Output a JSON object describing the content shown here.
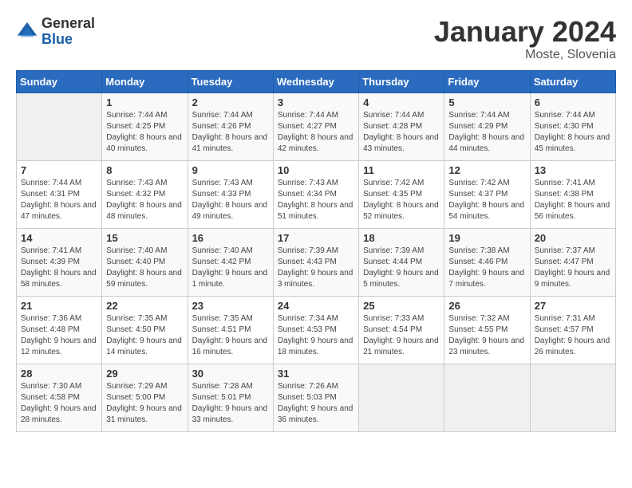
{
  "header": {
    "logo_general": "General",
    "logo_blue": "Blue",
    "title": "January 2024",
    "subtitle": "Moste, Slovenia"
  },
  "weekdays": [
    "Sunday",
    "Monday",
    "Tuesday",
    "Wednesday",
    "Thursday",
    "Friday",
    "Saturday"
  ],
  "weeks": [
    [
      {
        "day": "",
        "sunrise": "",
        "sunset": "",
        "daylight": "",
        "empty": true
      },
      {
        "day": "1",
        "sunrise": "Sunrise: 7:44 AM",
        "sunset": "Sunset: 4:25 PM",
        "daylight": "Daylight: 8 hours and 40 minutes."
      },
      {
        "day": "2",
        "sunrise": "Sunrise: 7:44 AM",
        "sunset": "Sunset: 4:26 PM",
        "daylight": "Daylight: 8 hours and 41 minutes."
      },
      {
        "day": "3",
        "sunrise": "Sunrise: 7:44 AM",
        "sunset": "Sunset: 4:27 PM",
        "daylight": "Daylight: 8 hours and 42 minutes."
      },
      {
        "day": "4",
        "sunrise": "Sunrise: 7:44 AM",
        "sunset": "Sunset: 4:28 PM",
        "daylight": "Daylight: 8 hours and 43 minutes."
      },
      {
        "day": "5",
        "sunrise": "Sunrise: 7:44 AM",
        "sunset": "Sunset: 4:29 PM",
        "daylight": "Daylight: 8 hours and 44 minutes."
      },
      {
        "day": "6",
        "sunrise": "Sunrise: 7:44 AM",
        "sunset": "Sunset: 4:30 PM",
        "daylight": "Daylight: 8 hours and 45 minutes."
      }
    ],
    [
      {
        "day": "7",
        "sunrise": "Sunrise: 7:44 AM",
        "sunset": "Sunset: 4:31 PM",
        "daylight": "Daylight: 8 hours and 47 minutes."
      },
      {
        "day": "8",
        "sunrise": "Sunrise: 7:43 AM",
        "sunset": "Sunset: 4:32 PM",
        "daylight": "Daylight: 8 hours and 48 minutes."
      },
      {
        "day": "9",
        "sunrise": "Sunrise: 7:43 AM",
        "sunset": "Sunset: 4:33 PM",
        "daylight": "Daylight: 8 hours and 49 minutes."
      },
      {
        "day": "10",
        "sunrise": "Sunrise: 7:43 AM",
        "sunset": "Sunset: 4:34 PM",
        "daylight": "Daylight: 8 hours and 51 minutes."
      },
      {
        "day": "11",
        "sunrise": "Sunrise: 7:42 AM",
        "sunset": "Sunset: 4:35 PM",
        "daylight": "Daylight: 8 hours and 52 minutes."
      },
      {
        "day": "12",
        "sunrise": "Sunrise: 7:42 AM",
        "sunset": "Sunset: 4:37 PM",
        "daylight": "Daylight: 8 hours and 54 minutes."
      },
      {
        "day": "13",
        "sunrise": "Sunrise: 7:41 AM",
        "sunset": "Sunset: 4:38 PM",
        "daylight": "Daylight: 8 hours and 56 minutes."
      }
    ],
    [
      {
        "day": "14",
        "sunrise": "Sunrise: 7:41 AM",
        "sunset": "Sunset: 4:39 PM",
        "daylight": "Daylight: 8 hours and 58 minutes."
      },
      {
        "day": "15",
        "sunrise": "Sunrise: 7:40 AM",
        "sunset": "Sunset: 4:40 PM",
        "daylight": "Daylight: 8 hours and 59 minutes."
      },
      {
        "day": "16",
        "sunrise": "Sunrise: 7:40 AM",
        "sunset": "Sunset: 4:42 PM",
        "daylight": "Daylight: 9 hours and 1 minute."
      },
      {
        "day": "17",
        "sunrise": "Sunrise: 7:39 AM",
        "sunset": "Sunset: 4:43 PM",
        "daylight": "Daylight: 9 hours and 3 minutes."
      },
      {
        "day": "18",
        "sunrise": "Sunrise: 7:39 AM",
        "sunset": "Sunset: 4:44 PM",
        "daylight": "Daylight: 9 hours and 5 minutes."
      },
      {
        "day": "19",
        "sunrise": "Sunrise: 7:38 AM",
        "sunset": "Sunset: 4:46 PM",
        "daylight": "Daylight: 9 hours and 7 minutes."
      },
      {
        "day": "20",
        "sunrise": "Sunrise: 7:37 AM",
        "sunset": "Sunset: 4:47 PM",
        "daylight": "Daylight: 9 hours and 9 minutes."
      }
    ],
    [
      {
        "day": "21",
        "sunrise": "Sunrise: 7:36 AM",
        "sunset": "Sunset: 4:48 PM",
        "daylight": "Daylight: 9 hours and 12 minutes."
      },
      {
        "day": "22",
        "sunrise": "Sunrise: 7:35 AM",
        "sunset": "Sunset: 4:50 PM",
        "daylight": "Daylight: 9 hours and 14 minutes."
      },
      {
        "day": "23",
        "sunrise": "Sunrise: 7:35 AM",
        "sunset": "Sunset: 4:51 PM",
        "daylight": "Daylight: 9 hours and 16 minutes."
      },
      {
        "day": "24",
        "sunrise": "Sunrise: 7:34 AM",
        "sunset": "Sunset: 4:53 PM",
        "daylight": "Daylight: 9 hours and 18 minutes."
      },
      {
        "day": "25",
        "sunrise": "Sunrise: 7:33 AM",
        "sunset": "Sunset: 4:54 PM",
        "daylight": "Daylight: 9 hours and 21 minutes."
      },
      {
        "day": "26",
        "sunrise": "Sunrise: 7:32 AM",
        "sunset": "Sunset: 4:55 PM",
        "daylight": "Daylight: 9 hours and 23 minutes."
      },
      {
        "day": "27",
        "sunrise": "Sunrise: 7:31 AM",
        "sunset": "Sunset: 4:57 PM",
        "daylight": "Daylight: 9 hours and 26 minutes."
      }
    ],
    [
      {
        "day": "28",
        "sunrise": "Sunrise: 7:30 AM",
        "sunset": "Sunset: 4:58 PM",
        "daylight": "Daylight: 9 hours and 28 minutes."
      },
      {
        "day": "29",
        "sunrise": "Sunrise: 7:29 AM",
        "sunset": "Sunset: 5:00 PM",
        "daylight": "Daylight: 9 hours and 31 minutes."
      },
      {
        "day": "30",
        "sunrise": "Sunrise: 7:28 AM",
        "sunset": "Sunset: 5:01 PM",
        "daylight": "Daylight: 9 hours and 33 minutes."
      },
      {
        "day": "31",
        "sunrise": "Sunrise: 7:26 AM",
        "sunset": "Sunset: 5:03 PM",
        "daylight": "Daylight: 9 hours and 36 minutes."
      },
      {
        "day": "",
        "sunrise": "",
        "sunset": "",
        "daylight": "",
        "empty": true
      },
      {
        "day": "",
        "sunrise": "",
        "sunset": "",
        "daylight": "",
        "empty": true
      },
      {
        "day": "",
        "sunrise": "",
        "sunset": "",
        "daylight": "",
        "empty": true
      }
    ]
  ]
}
